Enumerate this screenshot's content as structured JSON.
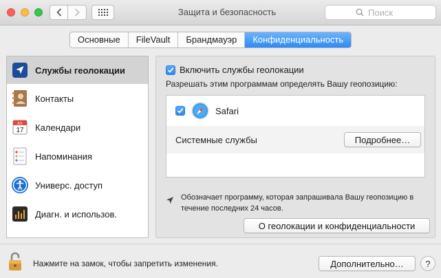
{
  "window": {
    "title": "Защита и безопасность"
  },
  "toolbar": {
    "search_placeholder": "Поиск"
  },
  "tabs": [
    {
      "label": "Основные",
      "active": false
    },
    {
      "label": "FileVault",
      "active": false
    },
    {
      "label": "Брандмауэр",
      "active": false
    },
    {
      "label": "Конфиденциальность",
      "active": true
    }
  ],
  "sidebar": {
    "items": [
      {
        "label": "Службы геолокации",
        "icon": "location-arrow-icon",
        "selected": true
      },
      {
        "label": "Контакты",
        "icon": "contacts-book-icon",
        "selected": false
      },
      {
        "label": "Календари",
        "icon": "calendar-icon",
        "selected": false,
        "icon_text_month": "JUL",
        "icon_text_day": "17"
      },
      {
        "label": "Напоминания",
        "icon": "reminders-icon",
        "selected": false
      },
      {
        "label": "Универс. доступ",
        "icon": "accessibility-icon",
        "selected": false
      },
      {
        "label": "Диагн. и использов.",
        "icon": "diagnostics-icon",
        "selected": false
      }
    ]
  },
  "main": {
    "enable_label": "Включить службы геолокации",
    "enable_checked": true,
    "allow_label": "Разрешать этим программам определять Вашу геопозицию:",
    "apps": [
      {
        "name": "Safari",
        "checked": true,
        "icon": "safari-compass-icon"
      }
    ],
    "system_services_label": "Системные службы",
    "details_button": "Подробнее…",
    "note_text": "Обозначает программу, которая запрашивала Вашу геопозицию в течение последних 24 часов.",
    "privacy_button": "О геолокации и конфиденциальности"
  },
  "footer": {
    "lock_text": "Нажмите на замок, чтобы запретить изменения.",
    "advanced_button": "Дополнительно…",
    "help_button": "?"
  },
  "colors": {
    "accent": "#2e8af6",
    "traffic_close": "#fc605c",
    "traffic_min": "#fdbc40",
    "traffic_zoom": "#34c84a"
  }
}
